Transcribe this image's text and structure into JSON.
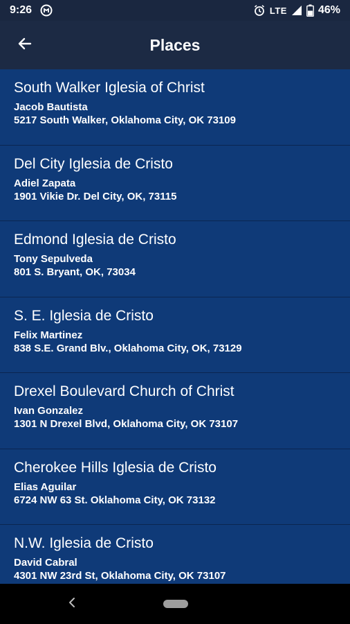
{
  "status_bar": {
    "time": "9:26",
    "network": "LTE",
    "battery": "46%",
    "icons": [
      "notification-icon",
      "alarm-icon",
      "signal-icon",
      "battery-icon"
    ]
  },
  "app_bar": {
    "title": "Places",
    "back_icon": "arrow-left-icon"
  },
  "places": [
    {
      "name": "South Walker Iglesia of Christ",
      "contact": "Jacob Bautista",
      "address": "5217 South Walker, Oklahoma City, OK 73109"
    },
    {
      "name": "Del City Iglesia de Cristo",
      "contact": "Adiel Zapata",
      "address": "1901 Vikie Dr. Del City, OK, 73115"
    },
    {
      "name": "Edmond Iglesia de Cristo",
      "contact": "Tony Sepulveda",
      "address": "801 S. Bryant, OK, 73034"
    },
    {
      "name": "S. E. Iglesia de Cristo",
      "contact": "Felix Martinez",
      "address": "838 S.E. Grand Blv., Oklahoma City, OK, 73129"
    },
    {
      "name": "Drexel Boulevard Church of Christ",
      "contact": "Ivan Gonzalez",
      "address": "1301 N Drexel Blvd, Oklahoma City, OK 73107"
    },
    {
      "name": "Cherokee Hills Iglesia de Cristo",
      "contact": "Elias Aguilar",
      "address": "6724 NW 63 St. Oklahoma City, OK 73132"
    },
    {
      "name": "N.W. Iglesia de Cristo",
      "contact": "David Cabral",
      "address": "4301 NW 23rd St, Oklahoma City, OK 73107"
    }
  ],
  "colors": {
    "list_background": "#0f3a78",
    "app_bar_background": "#1c2a44",
    "status_bar_background": "#1a2740",
    "divider": "#0a2550",
    "text": "#ffffff"
  }
}
